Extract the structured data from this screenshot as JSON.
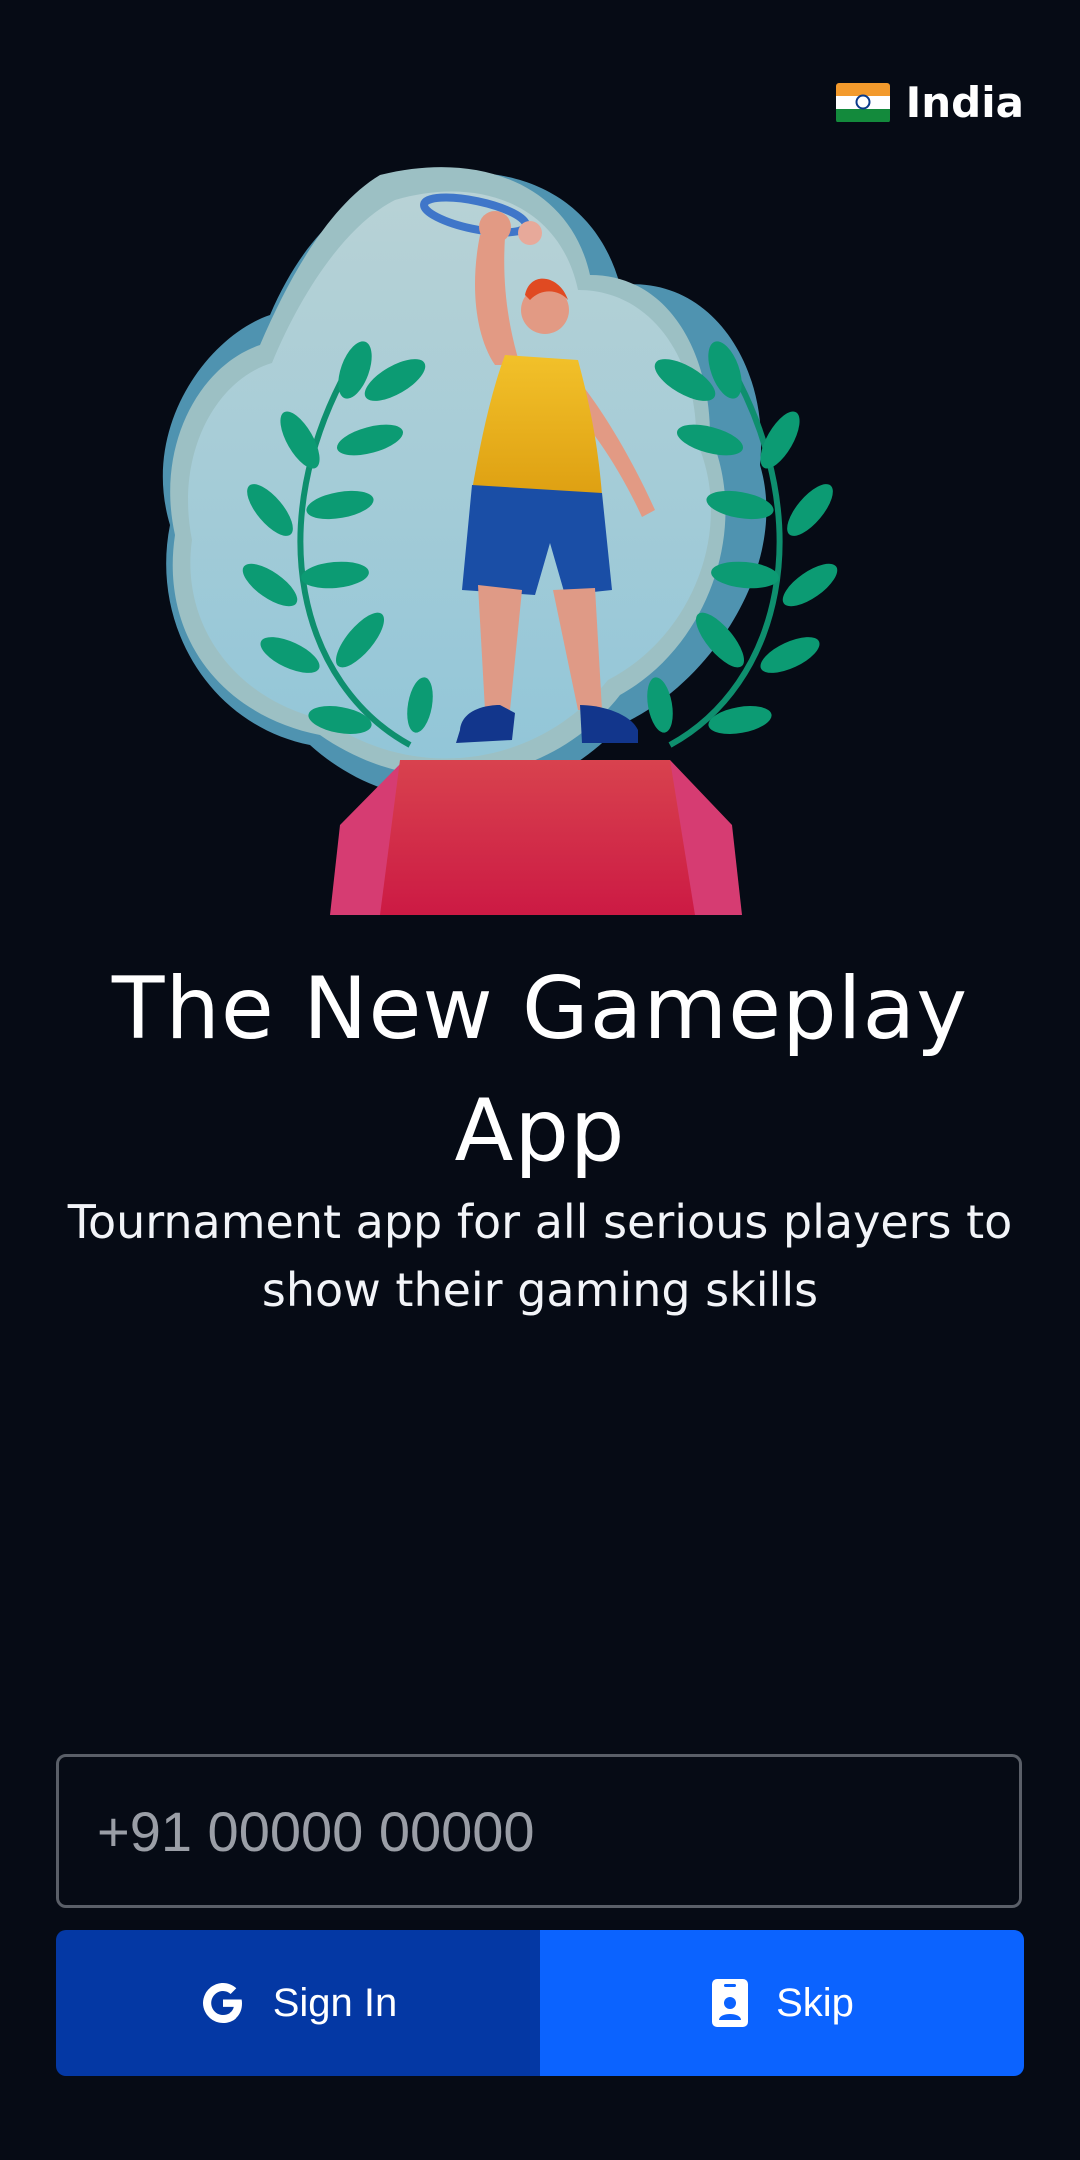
{
  "header": {
    "country_label": "India",
    "flag_icon": "india-flag-icon"
  },
  "hero": {
    "illustration": "trophy-winner-illustration"
  },
  "main": {
    "title": "The New Gameplay App",
    "subtitle": "Tournament app for all serious players to show their gaming skills"
  },
  "phone_input": {
    "placeholder": "+91 00000 00000",
    "value": ""
  },
  "actions": {
    "signin_label": "Sign In",
    "signin_icon": "google-icon",
    "skip_label": "Skip",
    "skip_icon": "phone-badge-icon"
  },
  "colors": {
    "background": "#060b15",
    "signin_bg": "#0438a4",
    "skip_bg": "#0b63ff"
  }
}
